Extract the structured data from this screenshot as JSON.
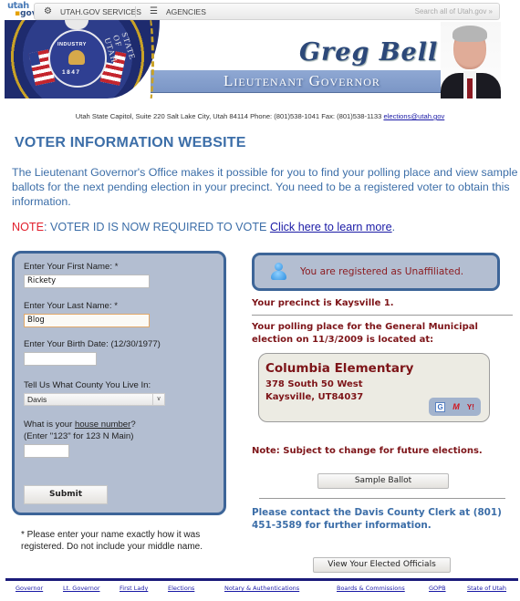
{
  "topbar": {
    "logo_top": "utah",
    "logo_bottom": "gov",
    "services_label": "UTAH.GOV SERVICES",
    "agencies_label": "AGENCIES",
    "search_placeholder": "Search all of Utah.gov »",
    "icons": {
      "services": "gear-icon",
      "agencies": "list-icon"
    }
  },
  "banner": {
    "seal_motto": "INDUSTRY",
    "seal_year": "1847",
    "seal_rim_text": "STATE OF UTAH",
    "name": "Greg Bell",
    "title": "Lieutenant Governor"
  },
  "address": {
    "text": "Utah State Capitol, Suite 220 Salt Lake City, Utah 84114 Phone: (801)538-1041 Fax: (801)538-1133 ",
    "email": "elections@utah.gov"
  },
  "page_title": "VOTER INFORMATION WEBSITE",
  "intro": "The Lieutenant Governor's Office makes it possible for you to find your polling place and view sample ballots for the next pending election in your precinct. You need to be a registered voter to obtain this information.",
  "note": {
    "label": "NOTE",
    "text": ": VOTER ID IS NOW REQUIRED TO VOTE ",
    "link": "Click here to learn more",
    "end": "."
  },
  "form": {
    "first_name_label": "Enter Your First Name: *",
    "first_name_value": "Rickety",
    "last_name_label": "Enter Your Last Name: *",
    "last_name_value": "Blog",
    "birth_date_label": "Enter Your Birth Date: (12/30/1977)",
    "birth_date_value": "",
    "county_label": "Tell Us What County You Live In:",
    "county_selected": "Davis",
    "house_label_pre": "What is your ",
    "house_label_link": "house number",
    "house_label_post": "?",
    "house_hint": "(Enter \"123\" for 123 N Main)",
    "house_value": "",
    "submit_label": "Submit"
  },
  "footnote": "* Please enter your name exactly how it was registered. Do not include your middle name.",
  "result": {
    "registration": "You are registered as Unaffiliated.",
    "precinct": "Your precinct is Kaysville 1.",
    "polling_intro": "Your polling place for the General Municipal election on 11/3/2009 is located at:",
    "place_name": "Columbia Elementary",
    "place_street": "378 South 50 West",
    "place_city": "Kaysville, UT84037",
    "map_links": {
      "google": "G",
      "mapquest": "M",
      "yahoo": "Y!"
    },
    "future_note": "Note: Subject to change for future elections.",
    "sample_ballot_label": "Sample Ballot",
    "contact": "Please contact the Davis County Clerk at (801) 451-3589 for further information.",
    "officials_label": "View Your Elected Officials"
  },
  "footer": {
    "links": [
      "Governor",
      "Lt. Governor",
      "First Lady",
      "Elections",
      "Notary & Authentications",
      "Boards & Commissions",
      "GOPB",
      "State of Utah"
    ]
  },
  "colors": {
    "title_blue": "#3c6ea8",
    "note_red": "#e2202d",
    "result_red": "#7d1418",
    "panel_bg": "#b3bed1",
    "panel_border": "#3d6598",
    "footer_bar": "#1b1b7a"
  }
}
